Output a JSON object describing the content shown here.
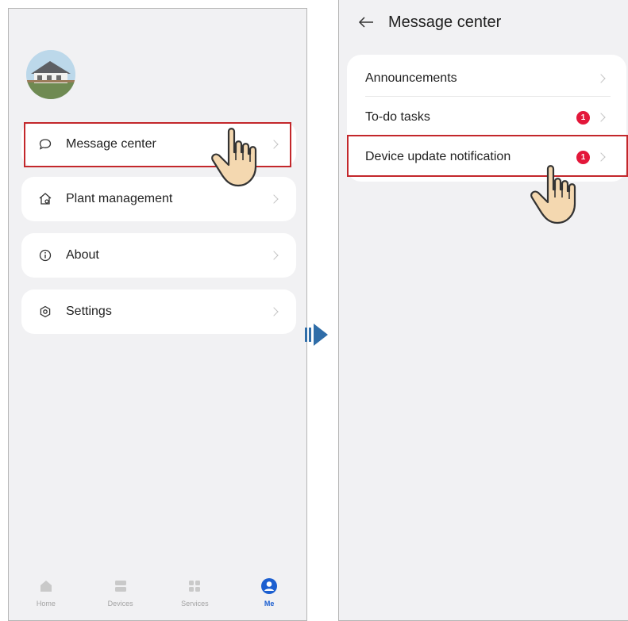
{
  "left_screen": {
    "menu": [
      {
        "label": "Message center",
        "icon": "chat-bubble-icon"
      },
      {
        "label": "Plant management",
        "icon": "house-settings-icon"
      },
      {
        "label": "About",
        "icon": "info-icon"
      },
      {
        "label": "Settings",
        "icon": "gear-icon"
      }
    ],
    "bottom_nav": [
      {
        "label": "Home",
        "icon": "home-icon"
      },
      {
        "label": "Devices",
        "icon": "devices-icon"
      },
      {
        "label": "Services",
        "icon": "services-grid-icon"
      },
      {
        "label": "Me",
        "icon": "person-icon",
        "active": true
      }
    ]
  },
  "right_screen": {
    "title": "Message center",
    "items": [
      {
        "label": "Announcements",
        "badge": null
      },
      {
        "label": "To-do tasks",
        "badge": "1"
      },
      {
        "label": "Device update notification",
        "badge": "1"
      }
    ]
  },
  "colors": {
    "highlight": "#c3272b",
    "badge": "#e3173a",
    "active_nav": "#1c5fd0",
    "connector_arrow": "#2f6da8"
  }
}
